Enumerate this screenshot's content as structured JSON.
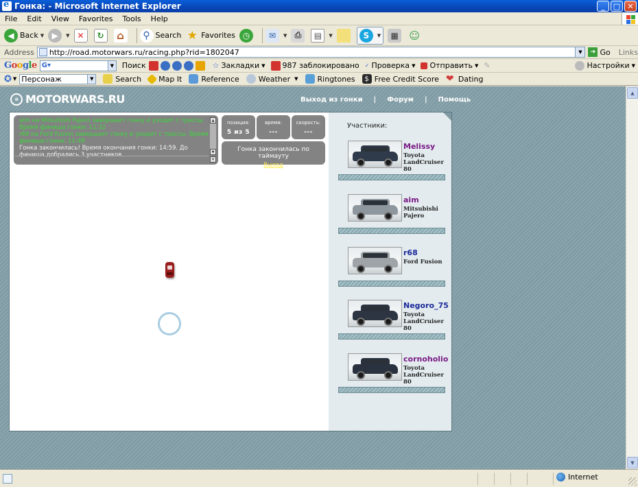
{
  "window": {
    "title": "Гонка: - Microsoft Internet Explorer"
  },
  "menu": [
    "File",
    "Edit",
    "View",
    "Favorites",
    "Tools",
    "Help"
  ],
  "toolbar": {
    "back": "Back",
    "search": "Search",
    "favorites": "Favorites"
  },
  "address": {
    "label": "Address",
    "url": "http://road.motorwars.ru/racing.php?rid=1802047",
    "go": "Go",
    "links": "Links"
  },
  "google_bar": {
    "logo": "Google",
    "field": "G▾",
    "search": "Поиск",
    "bookmarks": "Закладки",
    "blocked": "987 заблокировано",
    "check": "Проверка",
    "send": "Отправить",
    "settings": "Настройки"
  },
  "links_bar": {
    "persona": "Персонаж",
    "items": [
      "Search",
      "Map It",
      "Reference",
      "Weather",
      "Ringtones",
      "Free Credit Score",
      "Dating"
    ]
  },
  "site": {
    "logo": "MOTORWARS.RU",
    "nav": [
      "Выход из гонки",
      "Форум",
      "Помощь"
    ]
  },
  "race_log": [
    {
      "color": "g",
      "text": "aim на Mitsubishi Pajero завершает гонку и уходит с трассы. Время финиша гонки: 11:32"
    },
    {
      "color": "g",
      "text": "r68 на Ford Fusion завершает гонку и уходит с трассы. Время финиша гонки: 11:49"
    },
    {
      "color": "w",
      "text": "Гонка закончилась! Время окончания гонки: 14:59. До финиша добрались 3 участников"
    }
  ],
  "stats": {
    "position_label": "позиция:",
    "position_value": "5 из 5",
    "time_label": "время:",
    "time_value": "---",
    "speed_label": "скорость:",
    "speed_value": "---"
  },
  "timeout": {
    "message": "Гонка закончилась по таймауту",
    "exit": "Выход"
  },
  "participants_title": "Участники:",
  "participants": [
    {
      "name": "Melissy",
      "car": "Toyota LandCruiser 80",
      "name_color": "#7a1a86",
      "body_color": "#2f3a4a"
    },
    {
      "name": "aim",
      "car": "Mitsubishi Pajero",
      "name_color": "#7a1a86",
      "body_color": "#8e979e"
    },
    {
      "name": "r68",
      "car": "Ford Fusion",
      "name_color": "#1a2a9a",
      "body_color": "#9ea4a8"
    },
    {
      "name": "Negoro_75",
      "car": "Toyota LandCruiser 80",
      "name_color": "#1a2a9a",
      "body_color": "#2d3542"
    },
    {
      "name": "cornoholio",
      "car": "Toyota LandCruiser 80",
      "name_color": "#7a1a86",
      "body_color": "#2a3240"
    }
  ],
  "status": {
    "zone": "Internet"
  }
}
